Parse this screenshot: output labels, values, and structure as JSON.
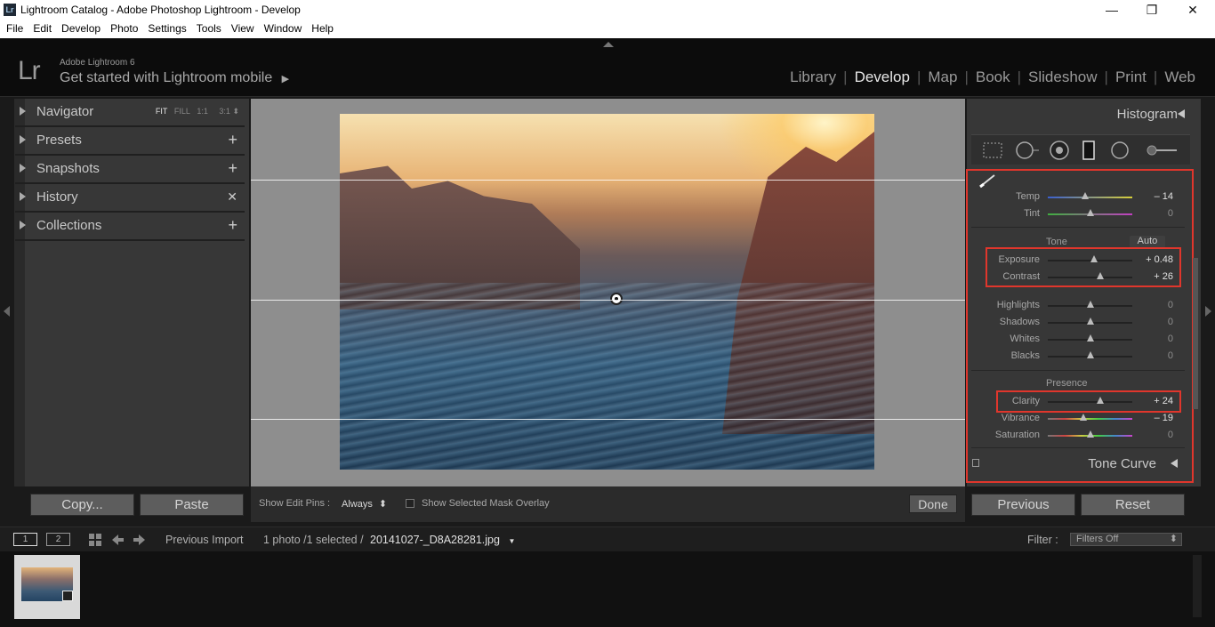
{
  "window": {
    "title": "Lightroom Catalog - Adobe Photoshop Lightroom - Develop",
    "app_icon": "Lr",
    "controls": [
      "—",
      "❐",
      "✕"
    ]
  },
  "menu": [
    "File",
    "Edit",
    "Develop",
    "Photo",
    "Settings",
    "Tools",
    "View",
    "Window",
    "Help"
  ],
  "header": {
    "logo": "Lr",
    "product": "Adobe Lightroom 6",
    "mobile": "Get started with Lightroom mobile",
    "mobile_arrow": "▶",
    "modules": [
      "Library",
      "Develop",
      "Map",
      "Book",
      "Slideshow",
      "Print",
      "Web"
    ],
    "active_module": "Develop",
    "separator": "|"
  },
  "left_panel": {
    "navigator": {
      "label": "Navigator",
      "fit": "FIT",
      "fill": "FILL",
      "one_to_one": "1:1",
      "three_to_one": "3:1",
      "stepper": "⬍"
    },
    "items": [
      {
        "label": "Presets",
        "action": "+"
      },
      {
        "label": "Snapshots",
        "action": "+"
      },
      {
        "label": "History",
        "action": "✕"
      },
      {
        "label": "Collections",
        "action": "+"
      }
    ],
    "copy": "Copy...",
    "paste": "Paste"
  },
  "toolbar": {
    "pins_label": "Show Edit Pins :",
    "pins_value": "Always",
    "pins_stepper": "⬍",
    "mask_label": "Show Selected Mask Overlay",
    "done": "Done"
  },
  "right_panel": {
    "histogram_title": "Histogram",
    "temp": {
      "label": "Temp",
      "value": "– 14",
      "position": 0.44
    },
    "tint": {
      "label": "Tint",
      "value": "0",
      "position": 0.5
    },
    "tone_title": "Tone",
    "auto": "Auto",
    "exposure": {
      "label": "Exposure",
      "value": "+ 0.48",
      "position": 0.55
    },
    "contrast": {
      "label": "Contrast",
      "value": "+ 26",
      "position": 0.62
    },
    "highlights": {
      "label": "Highlights",
      "value": "0",
      "position": 0.5
    },
    "shadows": {
      "label": "Shadows",
      "value": "0",
      "position": 0.5
    },
    "whites": {
      "label": "Whites",
      "value": "0",
      "position": 0.5
    },
    "blacks": {
      "label": "Blacks",
      "value": "0",
      "position": 0.5
    },
    "presence_title": "Presence",
    "clarity": {
      "label": "Clarity",
      "value": "+ 24",
      "position": 0.62
    },
    "vibrance": {
      "label": "Vibrance",
      "value": "– 19",
      "position": 0.42
    },
    "saturation": {
      "label": "Saturation",
      "value": "0",
      "position": 0.5
    },
    "tone_curve_title": "Tone Curve",
    "previous": "Previous",
    "reset": "Reset"
  },
  "filmstrip": {
    "screen1": "1",
    "screen2": "2",
    "source": "Previous Import",
    "count": "1 photo /1 selected /",
    "filename": "20141027-_D8A28281.jpg",
    "filename_arrow": "▼",
    "filter_label": "Filter :",
    "filter_value": "Filters Off",
    "filter_stepper": "⬍"
  },
  "colors": {
    "highlight_red": "#e0362c",
    "panel": "#373737",
    "canvas": "#8e8e8e"
  }
}
